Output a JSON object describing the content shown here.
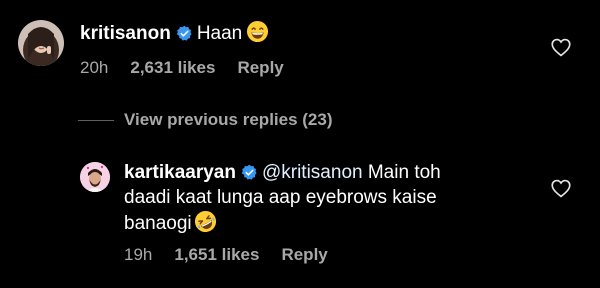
{
  "comments": [
    {
      "username": "kritisanon",
      "text": "Haan",
      "emoji": "grinning-face-with-smiling-eyes",
      "time": "20h",
      "likes": "2,631 likes",
      "reply": "Reply"
    }
  ],
  "view_previous": "View previous replies (23)",
  "replies": [
    {
      "username": "kartikaaryan",
      "mention": "@kritisanon",
      "text_line1": " Main toh",
      "text_line2": "daadi kaat lunga aap eyebrows kaise",
      "text_line3": "banaogi",
      "emoji": "rolling-on-floor-laughing",
      "time": "19h",
      "likes": "1,651 likes",
      "reply": "Reply"
    }
  ],
  "colors": {
    "background": "#000000",
    "text": "#ffffff",
    "muted": "#a8a8a8",
    "verified": "#3897f0",
    "mention": "#e0f1ff"
  },
  "icons": [
    "verified-badge-icon",
    "heart-outline-icon"
  ]
}
